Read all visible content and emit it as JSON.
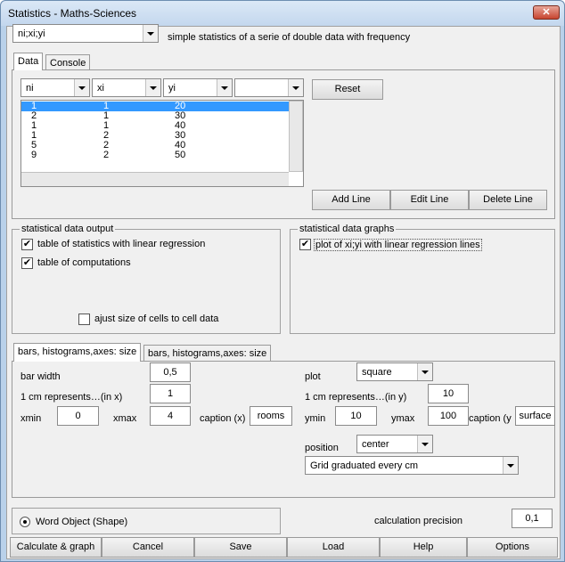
{
  "window": {
    "title": "Statistics - Maths-Sciences",
    "close": "✕"
  },
  "mode": {
    "value": "ni;xi;yi",
    "description": "simple statistics of a serie of double data with frequency"
  },
  "tabs_top": [
    "Data",
    "Console"
  ],
  "columns": [
    "ni",
    "xi",
    "yi",
    ""
  ],
  "rows": [
    [
      "1",
      "1",
      "20"
    ],
    [
      "2",
      "1",
      "30"
    ],
    [
      "1",
      "1",
      "40"
    ],
    [
      "1",
      "2",
      "30"
    ],
    [
      "5",
      "2",
      "40"
    ],
    [
      "9",
      "2",
      "50"
    ]
  ],
  "buttons": {
    "reset": "Reset",
    "add_line": "Add Line",
    "edit_line": "Edit Line",
    "delete_line": "Delete Line"
  },
  "output": {
    "title": "statistical data output",
    "opt1": "table of statistics with linear regression",
    "opt2": "table of computations",
    "opt3": "ajust size of cells to cell data",
    "check": "✔"
  },
  "graphs": {
    "title": "statistical data graphs",
    "opt1": "plot of xi;yi with linear regression lines"
  },
  "tabs_bottom": [
    "bars, histograms,axes: size",
    "bars, histograms,axes: size"
  ],
  "params": {
    "bar_width_label": "bar width",
    "bar_width": "0,5",
    "cm_x_label": "1 cm represents…(in x)",
    "cm_x": "1",
    "xmin_label": "xmin",
    "xmin": "0",
    "xmax_label": "xmax",
    "xmax": "4",
    "caption_x_label": "caption (x)",
    "caption_x": "rooms",
    "plot_label": "plot",
    "plot": "square",
    "cm_y_label": "1 cm represents…(in y)",
    "cm_y": "10",
    "ymin_label": "ymin",
    "ymin": "10",
    "ymax_label": "ymax",
    "ymax": "100",
    "caption_y_label": "caption (y",
    "caption_y": "surface",
    "position_label": "position",
    "position": "center",
    "grid": "Grid graduated every cm"
  },
  "word_object": "Word Object (Shape)",
  "precision_label": "calculation precision",
  "precision": "0,1",
  "bottom_buttons": [
    "Calculate & graph",
    "Cancel",
    "Save",
    "Load",
    "Help",
    "Options"
  ]
}
